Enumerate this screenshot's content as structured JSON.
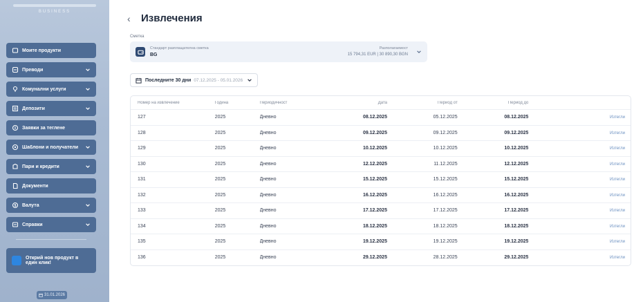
{
  "sidebar": {
    "logo_text": "BUSINESS",
    "items": [
      {
        "label": "Моите продукти",
        "icon": "products-icon",
        "has_chevron": false
      },
      {
        "label": "Преводи",
        "icon": "transfer-icon",
        "has_chevron": true
      },
      {
        "label": "Комунални услуги",
        "icon": "utilities-icon",
        "has_chevron": true
      },
      {
        "label": "Депозити",
        "icon": "deposit-icon",
        "has_chevron": true
      },
      {
        "label": "Заявки за теглене",
        "icon": "withdraw-icon",
        "has_chevron": false
      },
      {
        "label": "Шаблони и получатели",
        "icon": "templates-icon",
        "has_chevron": true
      },
      {
        "label": "Пари и кредити",
        "icon": "credit-icon",
        "has_chevron": true
      },
      {
        "label": "Документи",
        "icon": "documents-icon",
        "has_chevron": false
      },
      {
        "label": "Валута",
        "icon": "currency-icon",
        "has_chevron": true
      },
      {
        "label": "Справки",
        "icon": "reports-icon",
        "has_chevron": true
      }
    ],
    "promo": "Открий нов продукт в един клик!",
    "date": "31.01.2026"
  },
  "header": {
    "title": "Извлечения"
  },
  "account": {
    "label": "Сметка",
    "name_line1": "Стандарт разплащателна сметка",
    "name_line2": "BG",
    "balance_label": "Разполагаемост",
    "balance_value": "15 794,31 EUR | 30 890,30 BGN"
  },
  "period": {
    "label": "Последните 30 дни",
    "range": "07.12.2025 - 05.01.2026"
  },
  "table": {
    "columns": [
      "Номер на извлечение",
      "Година",
      "Периодичност",
      "Дата",
      "Период от",
      "Период до",
      ""
    ],
    "rows": [
      {
        "num": "127",
        "year": "2025",
        "freq": "Дневно",
        "date": "08.12.2025",
        "from": "05.12.2025",
        "to": "08.12.2025",
        "action": "Изтегли"
      },
      {
        "num": "128",
        "year": "2025",
        "freq": "Дневно",
        "date": "09.12.2025",
        "from": "09.12.2025",
        "to": "09.12.2025",
        "action": "Изтегли"
      },
      {
        "num": "129",
        "year": "2025",
        "freq": "Дневно",
        "date": "10.12.2025",
        "from": "10.12.2025",
        "to": "10.12.2025",
        "action": "Изтегли"
      },
      {
        "num": "130",
        "year": "2025",
        "freq": "Дневно",
        "date": "12.12.2025",
        "from": "11.12.2025",
        "to": "12.12.2025",
        "action": "Изтегли"
      },
      {
        "num": "131",
        "year": "2025",
        "freq": "Дневно",
        "date": "15.12.2025",
        "from": "15.12.2025",
        "to": "15.12.2025",
        "action": "Изтегли"
      },
      {
        "num": "132",
        "year": "2025",
        "freq": "Дневно",
        "date": "16.12.2025",
        "from": "16.12.2025",
        "to": "16.12.2025",
        "action": "Изтегли"
      },
      {
        "num": "133",
        "year": "2025",
        "freq": "Дневно",
        "date": "17.12.2025",
        "from": "17.12.2025",
        "to": "17.12.2025",
        "action": "Изтегли"
      },
      {
        "num": "134",
        "year": "2025",
        "freq": "Дневно",
        "date": "18.12.2025",
        "from": "18.12.2025",
        "to": "18.12.2025",
        "action": "Изтегли"
      },
      {
        "num": "135",
        "year": "2025",
        "freq": "Дневно",
        "date": "19.12.2025",
        "from": "19.12.2025",
        "to": "19.12.2025",
        "action": "Изтегли"
      },
      {
        "num": "136",
        "year": "2025",
        "freq": "Дневно",
        "date": "29.12.2025",
        "from": "28.12.2025",
        "to": "29.12.2025",
        "action": "Изтегли"
      }
    ]
  }
}
